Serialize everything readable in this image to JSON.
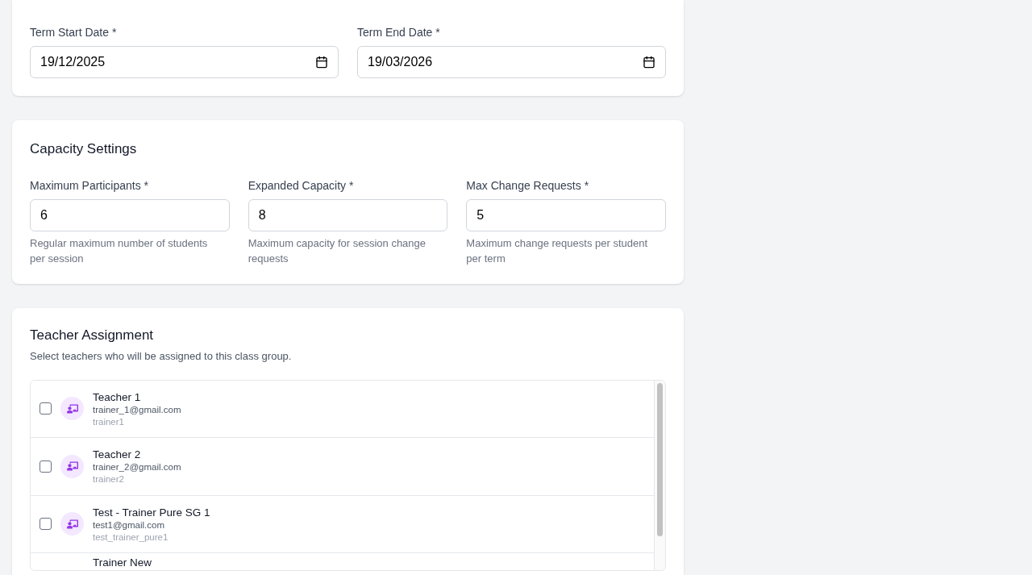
{
  "term_dates": {
    "fields": [
      {
        "label": "Term Start Date *",
        "value": "19/12/2025"
      },
      {
        "label": "Term End Date *",
        "value": "19/03/2026"
      }
    ]
  },
  "capacity_settings": {
    "title": "Capacity Settings",
    "fields": [
      {
        "label": "Maximum Participants *",
        "value": "6",
        "help": "Regular maximum number of students per session"
      },
      {
        "label": "Expanded Capacity *",
        "value": "8",
        "help": "Maximum capacity for session change requests"
      },
      {
        "label": "Max Change Requests *",
        "value": "5",
        "help": "Maximum change requests per student per term"
      }
    ]
  },
  "teacher_assignment": {
    "title": "Teacher Assignment",
    "description": "Select teachers who will be assigned to this class group.",
    "teachers": [
      {
        "name": "Teacher 1",
        "email": "trainer_1@gmail.com",
        "username": "trainer1",
        "checked": false
      },
      {
        "name": "Teacher 2",
        "email": "trainer_2@gmail.com",
        "username": "trainer2",
        "checked": false
      },
      {
        "name": "Test - Trainer Pure SG 1",
        "email": "test1@gmail.com",
        "username": "test_trainer_pure1",
        "checked": false
      },
      {
        "name": "Trainer New"
      }
    ]
  }
}
